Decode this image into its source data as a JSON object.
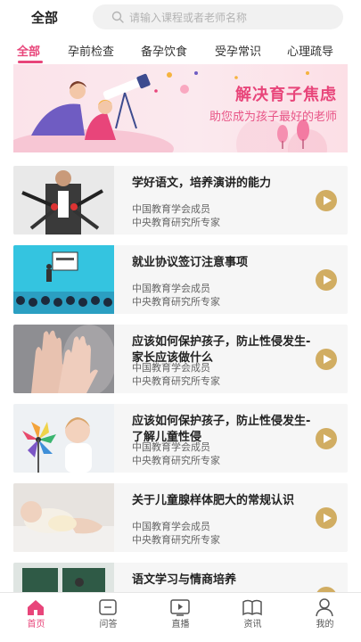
{
  "header": {
    "title": "全部",
    "search_placeholder": "请输入课程或者老师名称"
  },
  "tabs": [
    {
      "label": "全部",
      "active": true
    },
    {
      "label": "孕前检查",
      "active": false
    },
    {
      "label": "备孕饮食",
      "active": false
    },
    {
      "label": "受孕常识",
      "active": false
    },
    {
      "label": "心理疏导",
      "active": false
    }
  ],
  "banner": {
    "title": "解决育子焦虑",
    "subtitle": "助您成为孩子最好的老师"
  },
  "courses": [
    {
      "title": "学好语文，培养演讲的能力",
      "org1": "中国教育学会成员",
      "org2": "中央教育研究所专家"
    },
    {
      "title": "就业协议签订注意事项",
      "org1": "中国教育学会成员",
      "org2": "中央教育研究所专家"
    },
    {
      "title": "应该如何保护孩子，防止性侵发生-家长应该做什么",
      "org1": "中国教育学会成员",
      "org2": "中央教育研究所专家"
    },
    {
      "title": "应该如何保护孩子，防止性侵发生-了解儿童性侵",
      "org1": "中国教育学会成员",
      "org2": "中央教育研究所专家"
    },
    {
      "title": "关于儿童腺样体肥大的常规认识",
      "org1": "中国教育学会成员",
      "org2": "中央教育研究所专家"
    },
    {
      "title": "语文学习与情商培养",
      "org1": "",
      "org2": ""
    }
  ],
  "bottom_nav": [
    {
      "label": "首页",
      "icon": "home-icon",
      "active": true
    },
    {
      "label": "问答",
      "icon": "chat-icon",
      "active": false
    },
    {
      "label": "直播",
      "icon": "live-icon",
      "active": false
    },
    {
      "label": "资讯",
      "icon": "book-icon",
      "active": false
    },
    {
      "label": "我的",
      "icon": "user-icon",
      "active": false
    }
  ],
  "colors": {
    "accent": "#e8457a",
    "play": "#d1ad62"
  }
}
